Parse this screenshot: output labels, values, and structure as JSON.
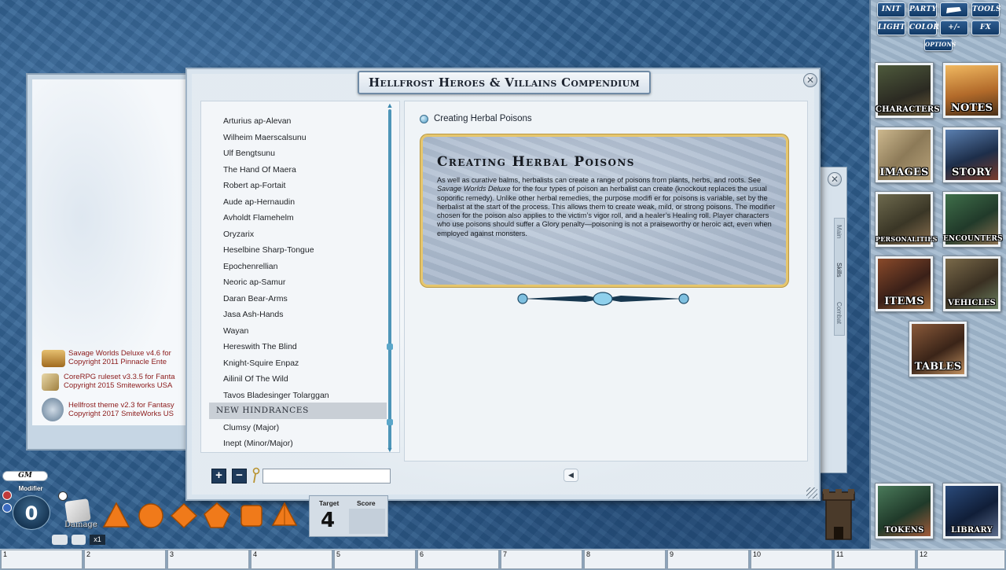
{
  "toolbar": {
    "buttons": [
      "INIT",
      "PARTY",
      "",
      "TOOLS",
      "LIGHT",
      "COLOR",
      "+/-",
      "FX",
      "OPTIONS"
    ]
  },
  "sidebar": {
    "tiles": [
      {
        "label": "CHARACTERS",
        "icon": "characters-icon"
      },
      {
        "label": "NOTES",
        "icon": "notes-icon"
      },
      {
        "label": "IMAGES",
        "icon": "images-icon"
      },
      {
        "label": "STORY",
        "icon": "story-icon"
      },
      {
        "label": "PERSONALITIES",
        "icon": "personalities-icon"
      },
      {
        "label": "ENCOUNTERS",
        "icon": "encounters-icon"
      },
      {
        "label": "ITEMS",
        "icon": "items-icon"
      },
      {
        "label": "VEHICLES",
        "icon": "vehicles-icon"
      },
      {
        "label": "TABLES",
        "icon": "tables-icon"
      },
      {
        "label": "TOKENS",
        "icon": "tokens-icon"
      },
      {
        "label": "LIBRARY",
        "icon": "library-icon"
      }
    ]
  },
  "background_window": {
    "credits": [
      {
        "line1": "Savage Worlds Deluxe v4.6 for",
        "line2": "Copyright 2011 Pinnacle Ente"
      },
      {
        "line1": "CoreRPG ruleset v3.3.5 for Fanta",
        "line2": "Copyright 2015 Smiteworks USA"
      },
      {
        "line1": "Hellfrost theme v2.3 for Fantasy",
        "line2": "Copyright 2017 SmiteWorks US"
      }
    ]
  },
  "compendium": {
    "title": "Hellfrost Heroes & Villains Compendium",
    "list_items": [
      "Arturius ap-Alevan",
      "Wilheim Maerscalsunu",
      "Ulf Bengtsunu",
      "The Hand Of Maera",
      "Robert ap-Fortait",
      "Aude ap-Hernaudin",
      "Avholdt Flamehelm",
      "Oryzarix",
      "Heselbine Sharp-Tongue",
      "Epochenrellian",
      "Neoric ap-Samur",
      "Daran Bear-Arms",
      "Jasa Ash-Hands",
      "Wayan",
      "Hereswith The Blind",
      "Knight-Squire Enpaz",
      "Ailinil Of The Wild",
      "Tavos Bladesinger Tolarggan"
    ],
    "section_header": "NEW HINDRANCES",
    "list_items_after": [
      "Clumsy (Major)",
      "Inept (Minor/Major)"
    ],
    "content_title": "Creating Herbal Poisons",
    "boxed_heading": "Creating Herbal Poisons",
    "boxed_body_1": "As well as curative balms, herbalists can create a range of poisons from plants, herbs, and roots. See ",
    "boxed_body_italic": "Savage Worlds Deluxe",
    "boxed_body_2": " for the four types of poison an herbalist can create (knockout replaces the usual soporific remedy). Unlike other herbal remedies, the purpose modifi er for poisons is variable, set by the herbalist at the start of the process. This allows them to create weak, mild, or strong poisons. The modifier chosen for the poison also applies to the victim’s vigor roll, and a healer’s Healing roll. Player characters who use poisons should suffer a Glory penalty—poisoning is not a praiseworthy or heroic act, even when employed against monsters.",
    "search_value": "",
    "add_symbol": "+",
    "remove_symbol": "−",
    "back_symbol": "◀",
    "close_symbol": "✕"
  },
  "bg_window2": {
    "close_symbol": "✕",
    "tabs": [
      "Main",
      "Skills",
      "Combat"
    ]
  },
  "bottom_left": {
    "gm_label": "GM",
    "modifier_label": "Modifier",
    "modifier_value": "0",
    "damage_label": "Damage",
    "dice": [
      "d4",
      "d6",
      "d8",
      "d10",
      "d12",
      "d20"
    ],
    "x1_label": "x1"
  },
  "score_panel": {
    "target_label": "Target",
    "score_label": "Score",
    "target_value": "4"
  },
  "hotkeys": [
    "1",
    "2",
    "3",
    "4",
    "5",
    "6",
    "7",
    "8",
    "9",
    "10",
    "11",
    "12"
  ],
  "colors": {
    "accent_gold": "#e6c66d",
    "list_header_bg": "#c9cfd6",
    "credit_red": "#8b1a1a"
  }
}
